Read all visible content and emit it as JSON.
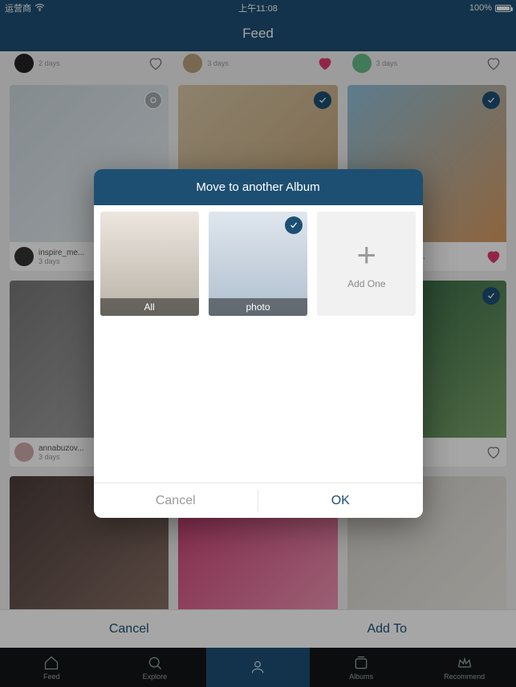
{
  "status": {
    "carrier": "运营商",
    "time": "上午11:08",
    "battery": "100%"
  },
  "nav": {
    "title": "Feed"
  },
  "feed": {
    "cards": [
      {
        "user": "",
        "time": "2 days"
      },
      {
        "user": "",
        "time": "3 days"
      },
      {
        "user": "",
        "time": "3 days"
      },
      {
        "user": "inspire_me...",
        "time": "3 days"
      },
      {
        "user": "",
        "time": ""
      },
      {
        "user": "e_home_de...",
        "time": ""
      },
      {
        "user": "annabuzov...",
        "time": "3 days"
      },
      {
        "user": "",
        "time": ""
      },
      {
        "user": "",
        "time": ""
      }
    ]
  },
  "actions": {
    "cancel": "Cancel",
    "addto": "Add To"
  },
  "tabs": {
    "items": [
      {
        "label": "Feed"
      },
      {
        "label": "Explore"
      },
      {
        "label": ""
      },
      {
        "label": "Albums"
      },
      {
        "label": "Recommend"
      }
    ]
  },
  "dialog": {
    "title": "Move to another Album",
    "albums": [
      {
        "label": "All",
        "selected": false
      },
      {
        "label": "photo",
        "selected": true
      }
    ],
    "add_label": "Add One",
    "cancel": "Cancel",
    "ok": "OK"
  }
}
